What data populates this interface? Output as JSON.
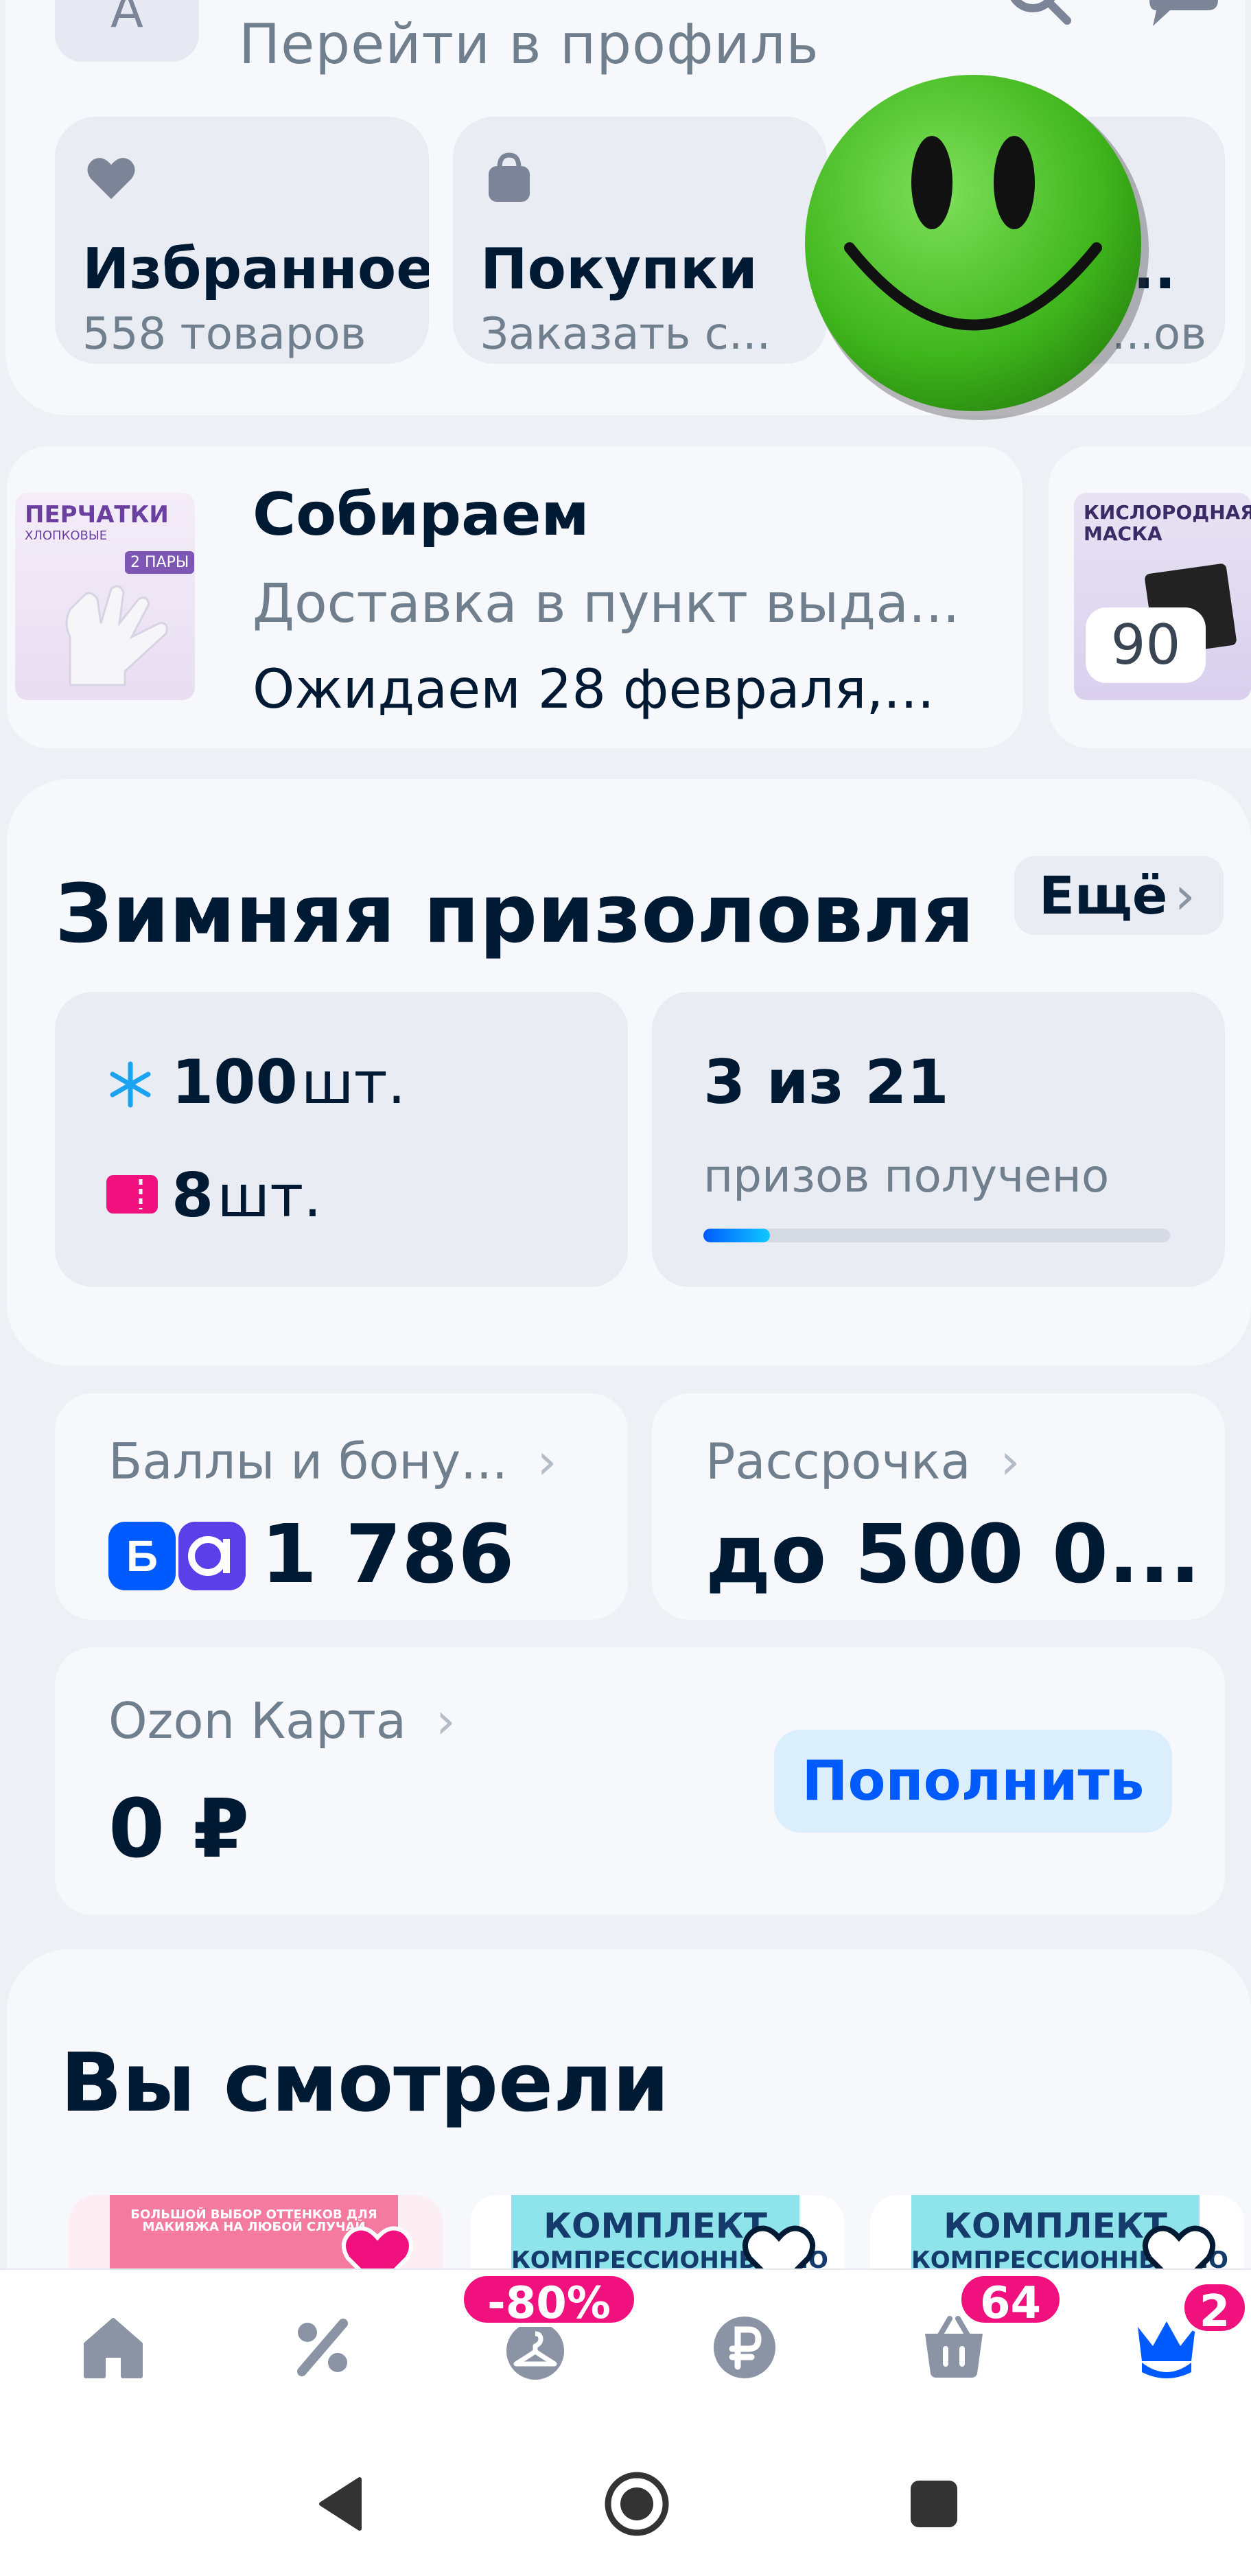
{
  "profile": {
    "avatar_letter": "А",
    "link_label": "Перейти в профиль"
  },
  "tiles": [
    {
      "title": "Избранное",
      "subtitle": "558 товаров",
      "icon": "heart-icon"
    },
    {
      "title": "Покупки",
      "subtitle": "Заказать с...",
      "icon": "bag-icon"
    },
    {
      "title": "...",
      "subtitle": "...ов",
      "icon": "unknown-icon"
    }
  ],
  "order": {
    "title": "Собираем",
    "status": "Доставка в пункт выда...",
    "eta": "Ожидаем 28 февраля,...",
    "thumb_text": "ПЕРЧАТКИ",
    "thumb_sub": "ХЛОПКОВЫЕ",
    "thumb_pairs": "2 ПАРЫ",
    "thumb2_text": "КИСЛОРОДНАЯ МАСКА",
    "second_count": "90"
  },
  "prize": {
    "title": "Зимняя призоловля",
    "more_label": "Ещё",
    "snowflakes_count": "100",
    "snowflakes_unit": "шт.",
    "tickets_count": "8",
    "tickets_unit": "шт.",
    "progress_text": "3 из 21",
    "progress_caption": "призов получено",
    "progress_fraction": 0.143
  },
  "balances": {
    "points_label": "Баллы и бону...",
    "points_value": "1 786",
    "installment_label": "Рассрочка",
    "installment_value": "до 500 0...",
    "card_label": "Ozon Карта",
    "card_value": "0 ₽",
    "topup_label": "Пополнить"
  },
  "viewed": {
    "title": "Вы смотрели",
    "products": [
      {
        "banner": "БОЛЬШОЙ ВЫБОР ОТТЕНКОВ ДЛЯ МАКИЯЖА НА ЛЮБОЙ СЛУЧАЙ",
        "favorite": true
      },
      {
        "banner": "КОМПЛЕКТ",
        "banner_sub": "КОМПРЕССИОННЫХ НО",
        "favorite": false
      },
      {
        "banner": "КОМПЛЕКТ",
        "banner_sub": "КОМПРЕССИОННЫХ НО",
        "favorite": false
      }
    ]
  },
  "nav": {
    "items": [
      "home-icon",
      "percent-icon",
      "hanger-icon",
      "ruble-icon",
      "cart-icon",
      "crown-icon"
    ],
    "sale_badge": "-80%",
    "cart_badge": "64",
    "profile_badge": "2"
  },
  "colors": {
    "accent": "#005bff",
    "badge": "#f1117e",
    "text": "#001a34",
    "muted": "#707f8d"
  }
}
